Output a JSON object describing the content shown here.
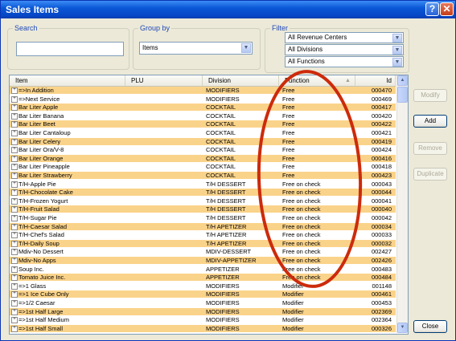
{
  "window": {
    "title": "Sales Items"
  },
  "titlebar": {
    "help_glyph": "?",
    "close_glyph": "✕"
  },
  "search": {
    "label": "Search",
    "value": ""
  },
  "group_by": {
    "label": "Group by",
    "selected": "Items"
  },
  "filter": {
    "label": "Filter",
    "revenue_center": "All Revenue Centers",
    "division": "All Divisions",
    "function": "All Functions"
  },
  "grid": {
    "columns": {
      "item": "Item",
      "plu": "PLU",
      "division": "Division",
      "function": "Function",
      "id": "Id"
    },
    "rows": [
      {
        "item": "=>In Addition",
        "plu": "",
        "division": "MODIFIERS",
        "function": "Free",
        "id": "000470"
      },
      {
        "item": "=>Next Service",
        "plu": "",
        "division": "MODIFIERS",
        "function": "Free",
        "id": "000469"
      },
      {
        "item": "Bar Liter Apple",
        "plu": "",
        "division": "COCKTAIL",
        "function": "Free",
        "id": "000417"
      },
      {
        "item": "Bar Liter Banana",
        "plu": "",
        "division": "COCKTAIL",
        "function": "Free",
        "id": "000420"
      },
      {
        "item": "Bar Liter Beet",
        "plu": "",
        "division": "COCKTAIL",
        "function": "Free",
        "id": "000422"
      },
      {
        "item": "Bar Liter Cantaloup",
        "plu": "",
        "division": "COCKTAIL",
        "function": "Free",
        "id": "000421"
      },
      {
        "item": "Bar Liter Celery",
        "plu": "",
        "division": "COCKTAIL",
        "function": "Free",
        "id": "000419"
      },
      {
        "item": "Bar Liter Ora/V-8",
        "plu": "",
        "division": "COCKTAIL",
        "function": "Free",
        "id": "000424"
      },
      {
        "item": "Bar Liter Orange",
        "plu": "",
        "division": "COCKTAIL",
        "function": "Free",
        "id": "000416"
      },
      {
        "item": "Bar Liter Pineapple",
        "plu": "",
        "division": "COCKTAIL",
        "function": "Free",
        "id": "000418"
      },
      {
        "item": "Bar Liter Strawberry",
        "plu": "",
        "division": "COCKTAIL",
        "function": "Free",
        "id": "000423"
      },
      {
        "item": "T/H-Apple Pie",
        "plu": "",
        "division": "T/H DESSERT",
        "function": "Free on check",
        "id": "000043"
      },
      {
        "item": "T/H-Chocolate Cake",
        "plu": "",
        "division": "T/H DESSERT",
        "function": "Free on check",
        "id": "000044"
      },
      {
        "item": "T/H-Frozen Yogurt",
        "plu": "",
        "division": "T/H DESSERT",
        "function": "Free on check",
        "id": "000041"
      },
      {
        "item": "T/H-Fruit Salad",
        "plu": "",
        "division": "T/H DESSERT",
        "function": "Free on check",
        "id": "000040"
      },
      {
        "item": "T/H-Sugar Pie",
        "plu": "",
        "division": "T/H DESSERT",
        "function": "Free on check",
        "id": "000042"
      },
      {
        "item": "T/H-Caesar Salad",
        "plu": "",
        "division": "T/H APETIZER",
        "function": "Free on check",
        "id": "000034"
      },
      {
        "item": "T/H-Chef's Salad",
        "plu": "",
        "division": "T/H APETIZER",
        "function": "Free on check",
        "id": "000033"
      },
      {
        "item": "T/H-Daily Soup",
        "plu": "",
        "division": "T/H APETIZER",
        "function": "Free on check",
        "id": "000032"
      },
      {
        "item": "Mdiv-No Dessert",
        "plu": "",
        "division": "MDIV-DESSERT",
        "function": "Free on check",
        "id": "002427"
      },
      {
        "item": "Mdiv-No Apps",
        "plu": "",
        "division": "MDIV-APPETIZER",
        "function": "Free on check",
        "id": "002426"
      },
      {
        "item": "Soup Inc.",
        "plu": "",
        "division": "APPETIZER",
        "function": "Free on check",
        "id": "000483"
      },
      {
        "item": "Tomato Juice Inc.",
        "plu": "",
        "division": "APPETIZER",
        "function": "Free on check",
        "id": "000484"
      },
      {
        "item": "=>1 Glass",
        "plu": "",
        "division": "MODIFIERS",
        "function": "Modifier",
        "id": "001148"
      },
      {
        "item": "=>1 Ice Cube Only",
        "plu": "",
        "division": "MODIFIERS",
        "function": "Modifier",
        "id": "000461"
      },
      {
        "item": "=>1/2 Caesar",
        "plu": "",
        "division": "MODIFIERS",
        "function": "Modifier",
        "id": "000453"
      },
      {
        "item": "=>1st Half Large",
        "plu": "",
        "division": "MODIFIERS",
        "function": "Modifier",
        "id": "002369"
      },
      {
        "item": "=>1st Half Medium",
        "plu": "",
        "division": "MODIFIERS",
        "function": "Modifier",
        "id": "002364"
      },
      {
        "item": "=>1st Half Small",
        "plu": "",
        "division": "MODIFIERS",
        "function": "Modifier",
        "id": "000326"
      }
    ]
  },
  "buttons": {
    "modify": "Modify",
    "add": "Add",
    "remove": "Remove",
    "duplicate": "Duplicate",
    "close": "Close"
  },
  "colors": {
    "row_highlight": "#fad38a",
    "annotation": "#cc2b0c",
    "titlebar": "#0b58d6"
  }
}
